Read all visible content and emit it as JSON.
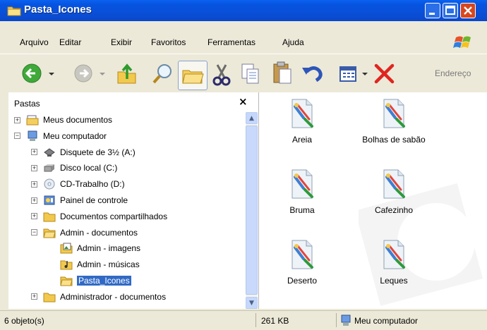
{
  "window": {
    "title": "Pasta_Icones"
  },
  "menu": [
    "Arquivo",
    "Editar",
    "Exibir",
    "Favoritos",
    "Ferramentas",
    "Ajuda"
  ],
  "toolbar": {
    "address_label": "Endereço",
    "icons": [
      "back-icon",
      "forward-icon",
      "up-folder-icon",
      "search-icon",
      "folders-icon",
      "cut-icon",
      "copy-icon",
      "paste-icon",
      "undo-icon",
      "views-icon",
      "delete-icon"
    ]
  },
  "folders_pane": {
    "title": "Pastas",
    "close": "×",
    "tree": [
      {
        "label": "Meus documentos",
        "expander": "+",
        "icon": "my-documents-icon"
      },
      {
        "label": "Meu computador",
        "expander": "−",
        "icon": "my-computer-icon"
      },
      {
        "label": "Disquete de 3½ (A:)",
        "expander": "+",
        "icon": "floppy-icon"
      },
      {
        "label": "Disco local (C:)",
        "expander": "+",
        "icon": "hard-disk-icon"
      },
      {
        "label": "CD-Trabalho (D:)",
        "expander": "+",
        "icon": "cd-drive-icon"
      },
      {
        "label": "Painel de controle",
        "expander": "+",
        "icon": "control-panel-icon"
      },
      {
        "label": "Documentos compartilhados",
        "expander": "+",
        "icon": "folder-icon"
      },
      {
        "label": "Admin - documentos",
        "expander": "−",
        "icon": "folder-open-icon"
      },
      {
        "label": "Admin - imagens",
        "expander": "",
        "icon": "pictures-folder-icon"
      },
      {
        "label": "Admin - músicas",
        "expander": "",
        "icon": "music-folder-icon"
      },
      {
        "label": "Pasta_Icones",
        "expander": "",
        "icon": "folder-open-icon",
        "selected": true
      },
      {
        "label": "Administrador - documentos",
        "expander": "+",
        "icon": "folder-icon"
      }
    ]
  },
  "files": [
    {
      "name": "Areia",
      "icon": "theme-file-icon"
    },
    {
      "name": "Bolhas de sabão",
      "icon": "theme-file-icon"
    },
    {
      "name": "Bruma",
      "icon": "theme-file-icon"
    },
    {
      "name": "Cafezinho",
      "icon": "theme-file-icon"
    },
    {
      "name": "Deserto",
      "icon": "theme-file-icon"
    },
    {
      "name": "Leques",
      "icon": "theme-file-icon"
    }
  ],
  "status": {
    "objects": "6 objeto(s)",
    "size": "261 KB",
    "location": "Meu computador"
  },
  "colors": {
    "titlebar": "#0a58e6",
    "selection": "#316ac5",
    "close": "#d8461e"
  }
}
